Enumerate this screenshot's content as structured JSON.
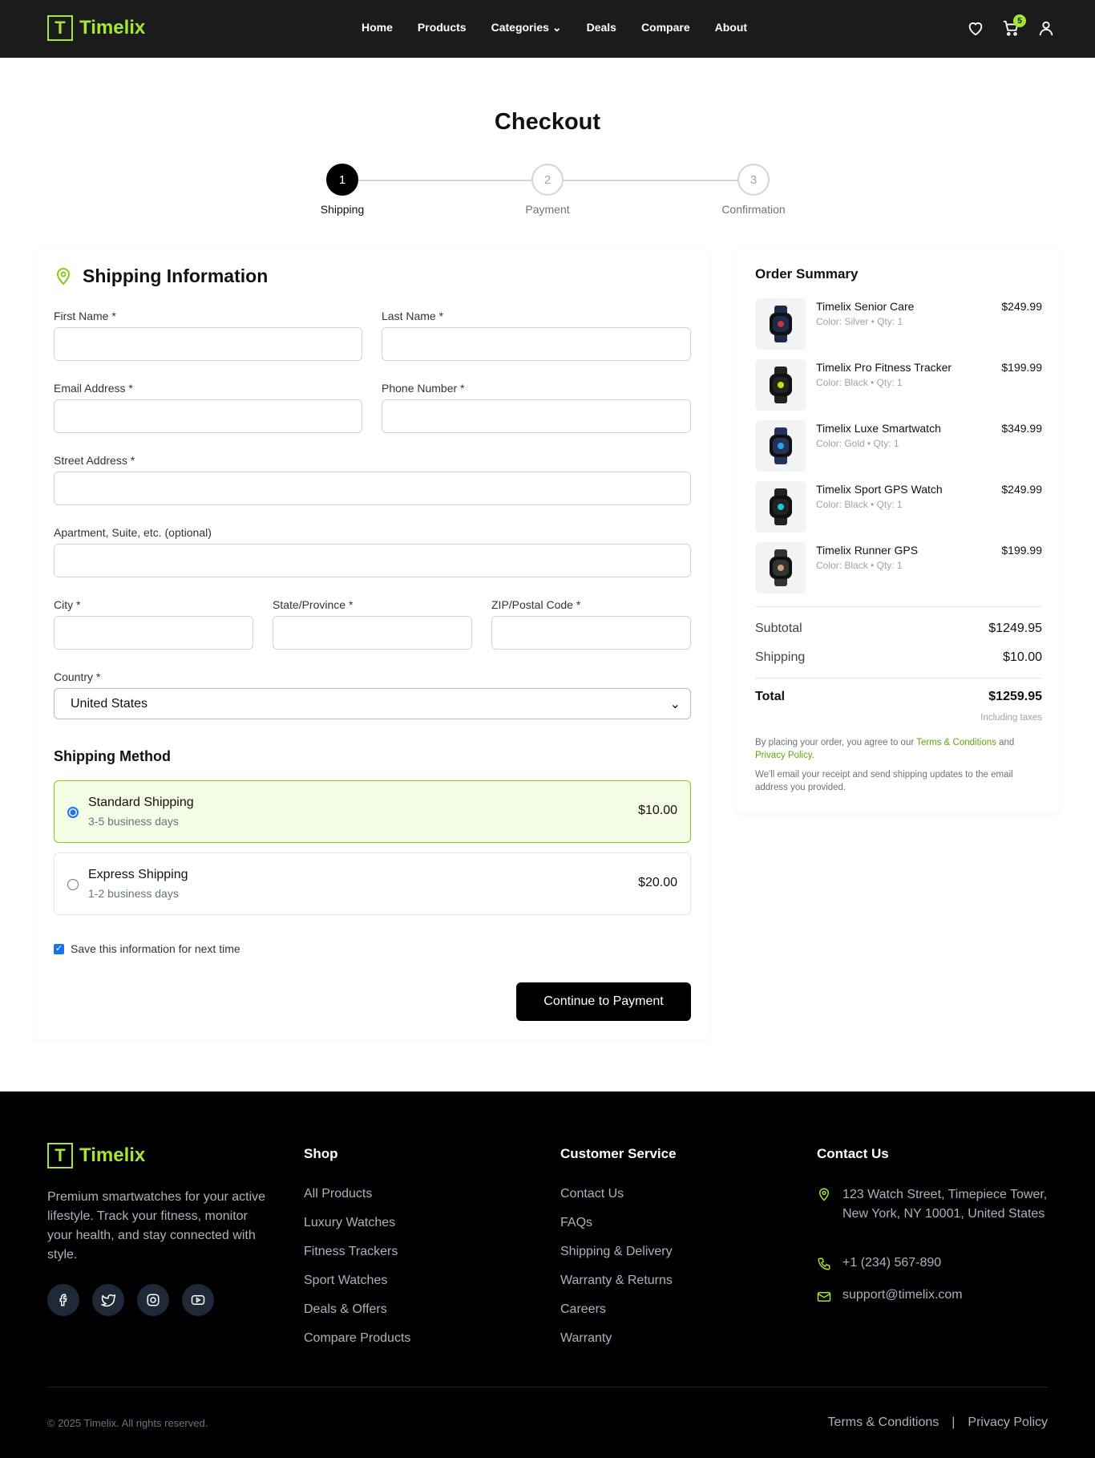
{
  "brand": {
    "name": "Timelix",
    "letter": "T",
    "accent": "#a3e635"
  },
  "nav": {
    "items": [
      "Home",
      "Products",
      "Categories",
      "Deals",
      "Compare",
      "About"
    ],
    "cart_count": "5"
  },
  "page_title": "Checkout",
  "steps": [
    {
      "n": "1",
      "label": "Shipping",
      "active": true
    },
    {
      "n": "2",
      "label": "Payment"
    },
    {
      "n": "3",
      "label": "Confirmation"
    }
  ],
  "shipping": {
    "title": "Shipping Information",
    "fields": {
      "first": "First Name *",
      "last": "Last Name *",
      "email": "Email Address *",
      "phone": "Phone Number *",
      "street": "Street Address *",
      "apt": "Apartment, Suite, etc. (optional)",
      "city": "City *",
      "state": "State/Province *",
      "zip": "ZIP/Postal Code *",
      "country": "Country *"
    },
    "country_value": "United States",
    "method_title": "Shipping Method",
    "methods": [
      {
        "name": "Standard Shipping",
        "days": "3-5 business days",
        "price": "$10.00",
        "selected": true
      },
      {
        "name": "Express Shipping",
        "days": "1-2 business days",
        "price": "$20.00"
      }
    ],
    "save_label": "Save this information for next time",
    "continue": "Continue to Payment"
  },
  "summary": {
    "title": "Order Summary",
    "items": [
      {
        "name": "Timelix Senior Care",
        "meta": "Color: Silver • Qty: 1",
        "price": "$249.99"
      },
      {
        "name": "Timelix Pro Fitness Tracker",
        "meta": "Color: Black • Qty: 1",
        "price": "$199.99"
      },
      {
        "name": "Timelix Luxe Smartwatch",
        "meta": "Color: Gold • Qty: 1",
        "price": "$349.99"
      },
      {
        "name": "Timelix Sport GPS Watch",
        "meta": "Color: Black • Qty: 1",
        "price": "$249.99"
      },
      {
        "name": "Timelix Runner GPS",
        "meta": "Color: Black • Qty: 1",
        "price": "$199.99"
      }
    ],
    "subtotal_label": "Subtotal",
    "subtotal": "$1249.95",
    "shipping_label": "Shipping",
    "shipping": "$10.00",
    "total_label": "Total",
    "total": "$1259.95",
    "tax_note": "Including taxes",
    "agree_pre": "By placing your order, you agree to our ",
    "terms": "Terms & Conditions",
    "and": " and ",
    "privacy": "Privacy Policy",
    "period": ".",
    "email_note": "We'll email your receipt and send shipping updates to the email address you provided."
  },
  "footer": {
    "about": "Premium smartwatches for your active lifestyle. Track your fitness, monitor your health, and stay connected with style.",
    "shop_title": "Shop",
    "shop": [
      "All Products",
      "Luxury Watches",
      "Fitness Trackers",
      "Sport Watches",
      "Deals & Offers",
      "Compare Products"
    ],
    "cs_title": "Customer Service",
    "cs": [
      "Contact Us",
      "FAQs",
      "Shipping & Delivery",
      "Warranty & Returns",
      "Careers",
      "Warranty"
    ],
    "contact_title": "Contact Us",
    "address": "123 Watch Street, Timepiece Tower, New York, NY 10001, United States",
    "phone": "+1 (234) 567-890",
    "email": "support@timelix.com",
    "copyright": "© 2025 Timelix. All rights reserved.",
    "terms": "Terms & Conditions",
    "sep": "|",
    "privacy": "Privacy Policy"
  }
}
